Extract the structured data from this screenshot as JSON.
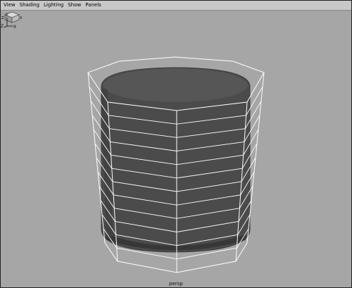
{
  "menubar": {
    "items": [
      {
        "label": "View"
      },
      {
        "label": "Shading"
      },
      {
        "label": "Lighting"
      },
      {
        "label": "Show"
      },
      {
        "label": "Panels"
      }
    ]
  },
  "viewport": {
    "camera_label": "persp",
    "background_color": "#a6a6a6",
    "mesh_fill_color": "#4b4b4b",
    "wireframe_color": "#ffffff",
    "cage_segments": 12,
    "view_cube_axes": [
      "Z",
      "X"
    ],
    "axis_gizmo_labels": [
      "Y",
      "Z",
      "X"
    ]
  },
  "icons": {
    "view_cube": "view-cube-icon",
    "axis_gizmo": "axis-gizmo-icon"
  }
}
